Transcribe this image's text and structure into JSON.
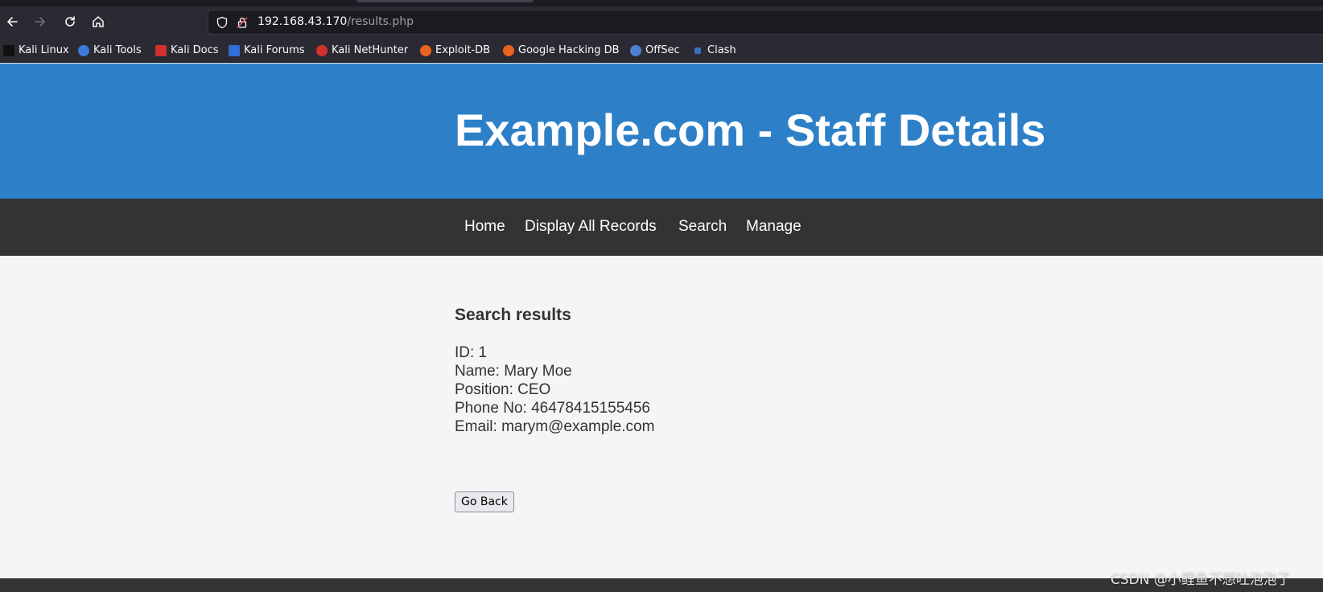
{
  "browser": {
    "url_host": "192.168.43.170",
    "url_path": "/results.php",
    "bookmarks": [
      {
        "label": "Kali Linux",
        "icon": "kali-dragon-icon",
        "color": "#111111"
      },
      {
        "label": "Kali Tools",
        "icon": "kali-tools-icon",
        "color": "#3a7bd5"
      },
      {
        "label": "Kali Docs",
        "icon": "kali-docs-icon",
        "color": "#d0312d"
      },
      {
        "label": "Kali Forums",
        "icon": "kali-forums-icon",
        "color": "#2f6fd6"
      },
      {
        "label": "Kali NetHunter",
        "icon": "kali-nethunter-icon",
        "color": "#d0312d"
      },
      {
        "label": "Exploit-DB",
        "icon": "exploit-db-icon",
        "color": "#e8631c"
      },
      {
        "label": "Google Hacking DB",
        "icon": "ghdb-icon",
        "color": "#e8631c"
      },
      {
        "label": "OffSec",
        "icon": "offsec-icon",
        "color": "#4a7fd4"
      },
      {
        "label": "Clash",
        "icon": "clash-icon",
        "color": "#3b6fc4"
      }
    ]
  },
  "page": {
    "title": "Example.com - Staff Details",
    "nav": [
      "Home",
      "Display All Records",
      "Search",
      "Manage"
    ],
    "results_heading": "Search results",
    "record": {
      "id": "ID: 1",
      "name": "Name: Mary Moe",
      "position": "Position: CEO",
      "phone": "Phone No: 46478415155456",
      "email": "Email: marym@example.com"
    },
    "go_back_label": "Go Back"
  },
  "watermark": "CSDN @小鲤鱼不想吐泡泡了",
  "colors": {
    "header_blue": "#2d80c8",
    "nav_dark": "#333333",
    "content_bg": "#f5f5f5",
    "browser_toolbar": "#2b2a33"
  }
}
